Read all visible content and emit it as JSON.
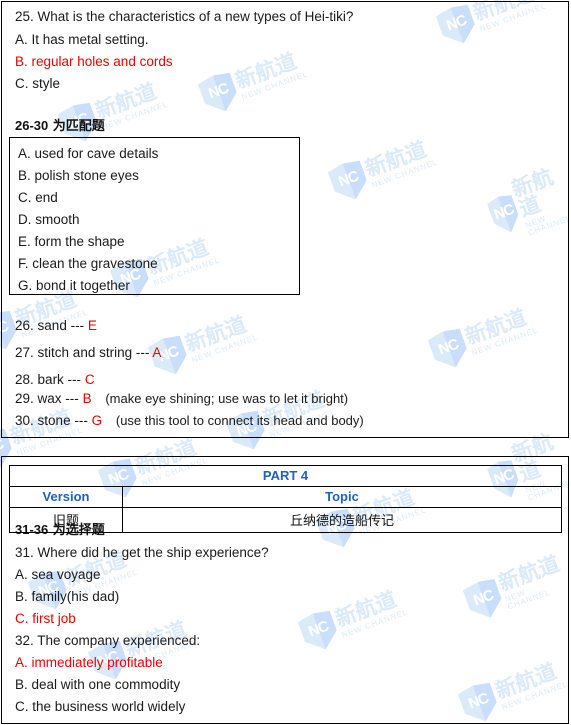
{
  "document": {
    "watermark": {
      "logo_mark": "NC",
      "chinese": "新航道",
      "english": "NEW CHANNEL",
      "color": "#dbeaf9"
    },
    "colors": {
      "answer_red": "#ee0000",
      "header_blue": "#2060c0",
      "body_black": "#1a1a1a",
      "border": "#000000"
    }
  },
  "block1": {
    "question25": {
      "stem": "25.  What is the characteristics of a new types of Hei-tiki?",
      "options": [
        {
          "label": "A.  It has metal setting.",
          "highlighted": false
        },
        {
          "label": "B.  regular holes and cords",
          "highlighted": true
        },
        {
          "label": "C.  style",
          "highlighted": false
        }
      ]
    },
    "matching_heading": {
      "range": "26-30",
      "text": " 为匹配题"
    },
    "options_box": {
      "items": [
        "A.  used for cave details",
        "B.  polish stone eyes",
        "C.  end",
        "D. smooth",
        "E. form the shape",
        "F. clean the gravestone",
        "G. bond it together"
      ]
    },
    "matching_answers": [
      {
        "number": "26.",
        "term": "sand ---",
        "answer": "E",
        "note": ""
      },
      {
        "number": "27.",
        "term": "stitch and string ---",
        "answer": "A",
        "note": ""
      },
      {
        "number": "28.",
        "term": "bark ---",
        "answer": "C",
        "note": ""
      },
      {
        "number": "29.",
        "term": "wax ---",
        "answer": "B",
        "note": "(make eye shining; use was to let it bright)"
      },
      {
        "number": "30.",
        "term": "stone ---",
        "answer": "G",
        "note": "(use this tool to connect its head and body)"
      }
    ]
  },
  "block2": {
    "table": {
      "part_title": "PART 4",
      "headers": {
        "version": "Version",
        "topic": "Topic"
      },
      "row": {
        "version": "旧题",
        "topic": "丘纳德的造船传记"
      }
    },
    "choice_heading": {
      "range": "31-36",
      "text": " 为选择题"
    },
    "question31": {
      "stem": "31.  Where did he get the ship experience?",
      "options": [
        {
          "label": "A.  sea voyage",
          "highlighted": false
        },
        {
          "label": "B.  family(his dad)",
          "highlighted": false
        },
        {
          "label": "C.  first job",
          "highlighted": true
        }
      ]
    },
    "question32": {
      "stem": "32.  The company experienced:",
      "options": [
        {
          "label": "A.  immediately profitable",
          "highlighted": true
        },
        {
          "label": "B.  deal with one commodity",
          "highlighted": false
        },
        {
          "label": "C.  the business world widely",
          "highlighted": false
        }
      ]
    }
  }
}
